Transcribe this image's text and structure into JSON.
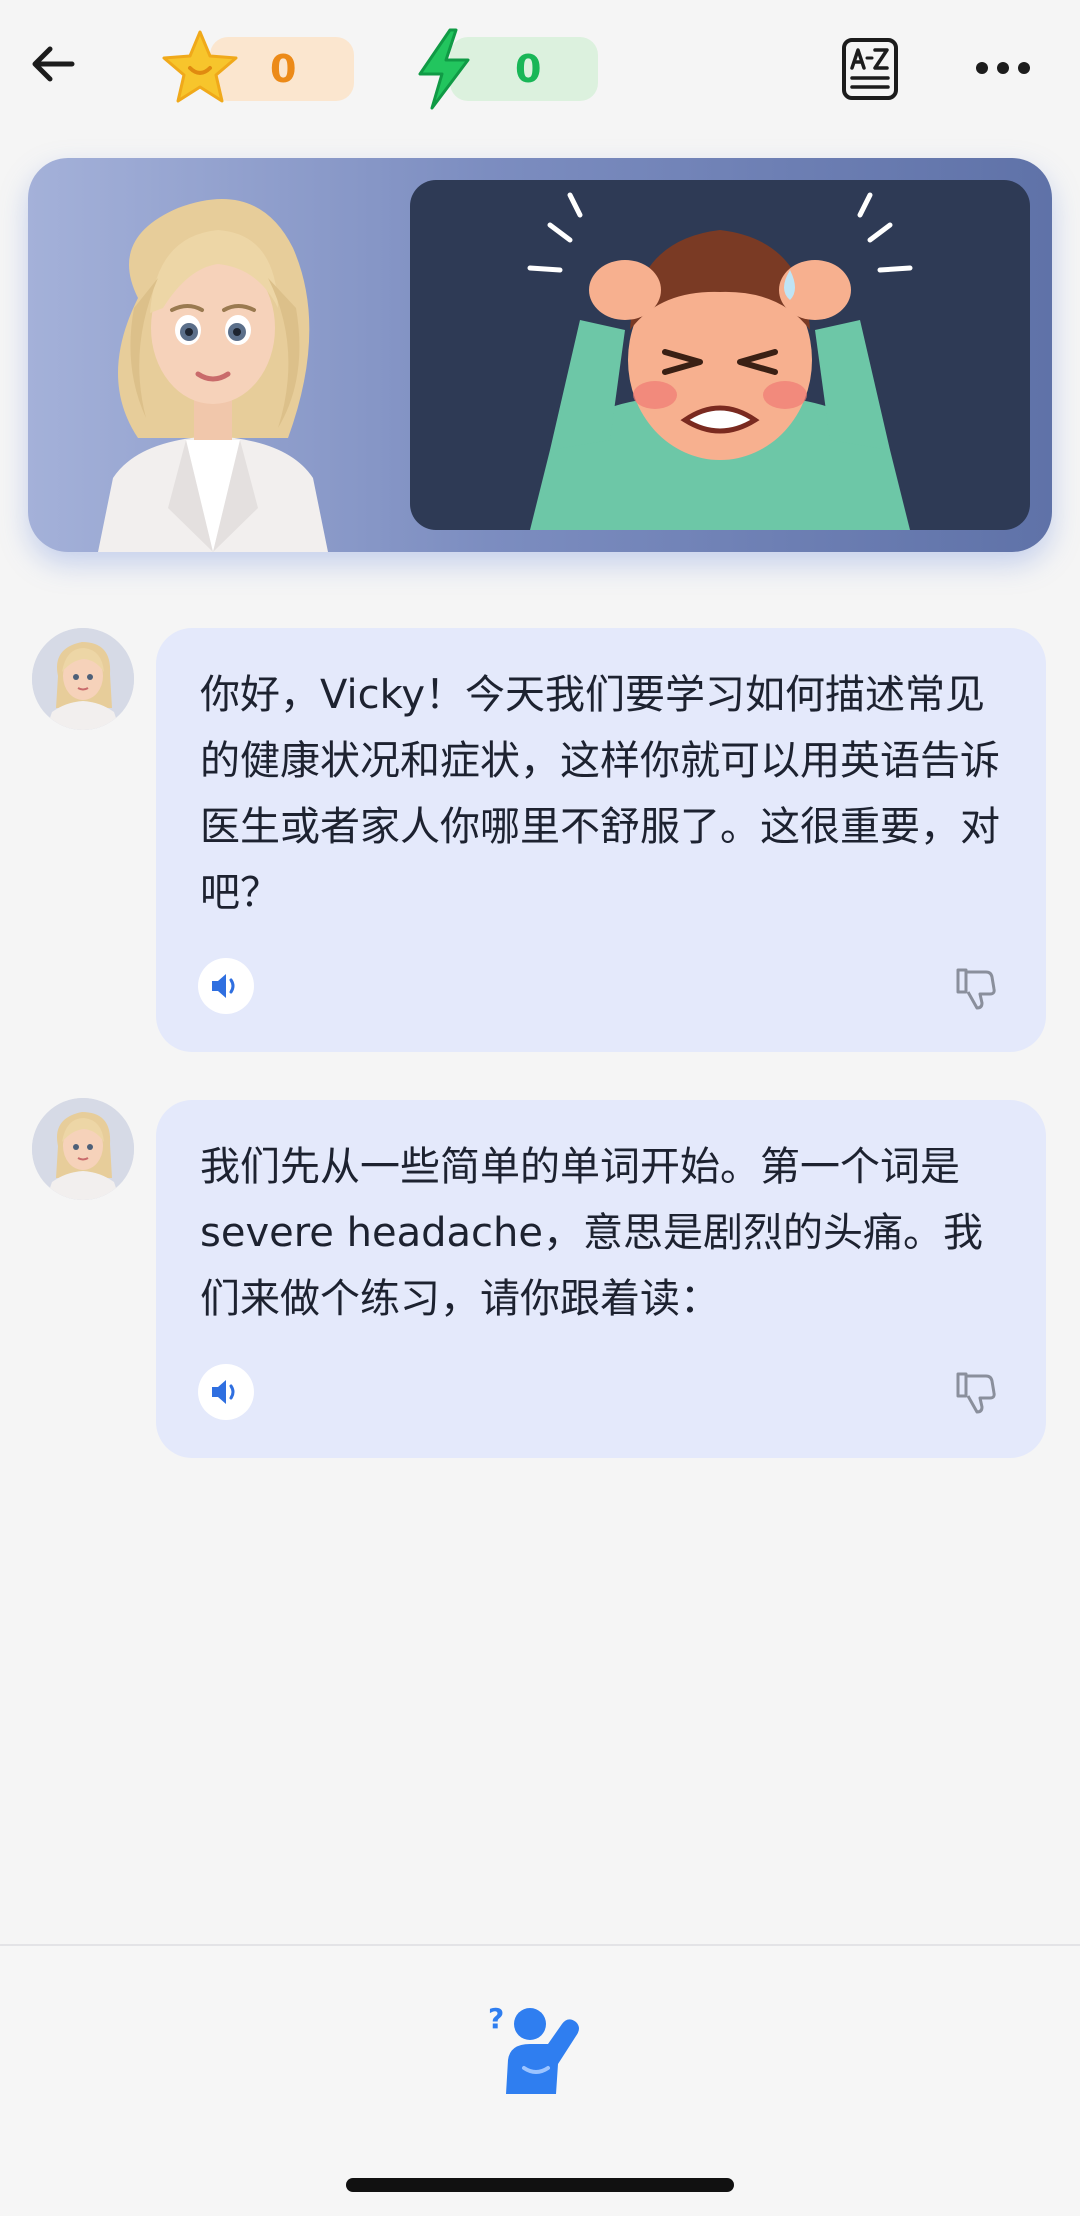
{
  "header": {
    "stars_count": "0",
    "energy_count": "0",
    "icons": {
      "back": "arrow-left-icon",
      "stars": "star-icon",
      "energy": "lightning-bolt-icon",
      "vocab": "a-z-dictionary-icon",
      "more": "more-horizontal-icon"
    },
    "colors": {
      "stars": "#ec8a18",
      "energy": "#19b657"
    }
  },
  "messages": [
    {
      "text": "你好，Vicky！今天我们要学习如何描述常见的健康状况和症状，这样你就可以用英语告诉医生或者家人你哪里不舒服了。这很重要，对吧？"
    },
    {
      "text": "我们先从一些简单的单词开始。第一个词是severe headache，意思是剧烈的头痛。我们来做个练习，请你跟着读："
    }
  ],
  "bottom": {
    "icon": "ask-question-icon",
    "accent": "#2f7ef0"
  }
}
